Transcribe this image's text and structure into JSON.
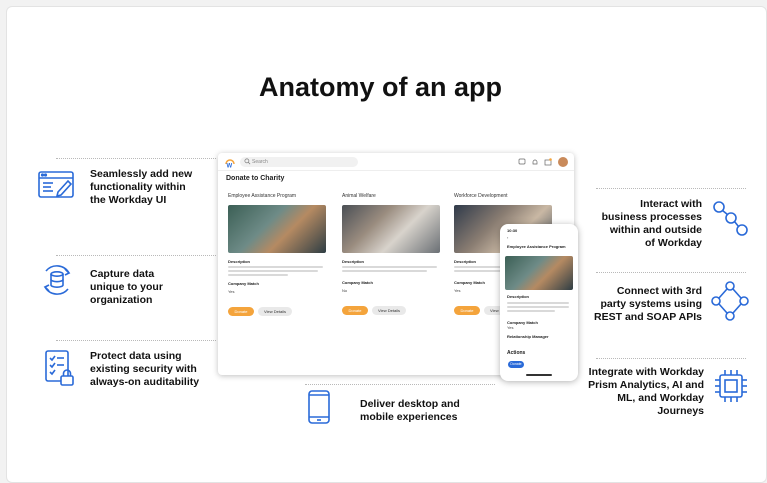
{
  "title": "Anatomy of an app",
  "features_left": [
    {
      "lines": [
        "Seamlessly add new",
        "functionality within",
        "the Workday UI"
      ],
      "icon": "browser-edit-icon"
    },
    {
      "lines": [
        "Capture data",
        "unique to your",
        "organization"
      ],
      "icon": "database-cycle-icon"
    },
    {
      "lines": [
        "Protect data using",
        "existing security with",
        "always-on auditability"
      ],
      "icon": "checklist-lock-icon"
    }
  ],
  "features_right": [
    {
      "lines": [
        "Interact with",
        "business processes",
        "within and outside",
        "of Workday"
      ],
      "icon": "process-nodes-icon"
    },
    {
      "lines": [
        "Connect with 3rd",
        "party systems using",
        "REST and SOAP APIs"
      ],
      "icon": "connection-diamond-icon"
    },
    {
      "lines": [
        "Integrate with Workday",
        "Prism Analytics, AI and",
        "ML, and Workday",
        "Journeys"
      ],
      "icon": "chip-icon"
    }
  ],
  "feature_bottom": {
    "lines": [
      "Deliver desktop and",
      "mobile experiences"
    ],
    "icon": "mobile-phone-icon"
  },
  "accent_color": "#2a6ad8",
  "mock_app": {
    "search_placeholder": "Search",
    "page_title": "Donate to Charity",
    "columns": [
      {
        "title": "Employee Assistance Program",
        "desc_label": "Description",
        "match_label": "Company Match",
        "match_value": "Yes",
        "donate": "Donate",
        "details": "View Details"
      },
      {
        "title": "Animal Welfare",
        "desc_label": "Description",
        "match_label": "Company Match",
        "match_value": "No",
        "donate": "Donate",
        "details": "View Details"
      },
      {
        "title": "Workforce Development",
        "desc_label": "Description",
        "match_label": "Company Match",
        "match_value": "Yes",
        "donate": "Donate",
        "details": "View Details"
      }
    ],
    "phone": {
      "time": "10:30",
      "title": "Employee Assistance Program",
      "desc_label": "Description",
      "match_label": "Company Match",
      "match_value": "Yes",
      "manager_label": "Relationship Manager",
      "actions_label": "Actions",
      "donate": "Donate"
    }
  }
}
